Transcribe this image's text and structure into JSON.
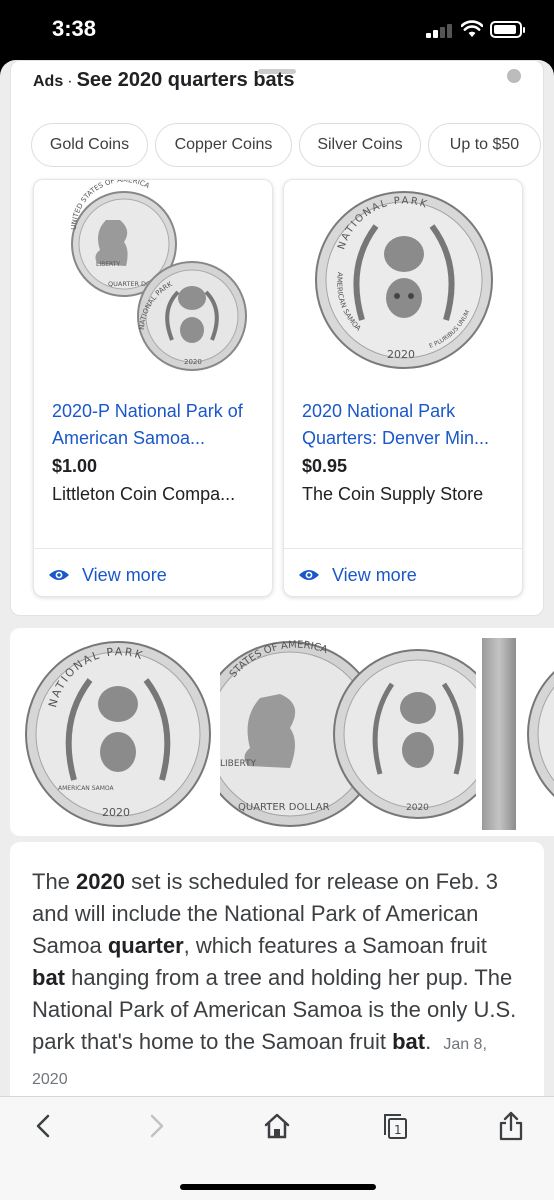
{
  "status_bar": {
    "time": "3:38"
  },
  "ads": {
    "label": "Ads",
    "separator": "·",
    "title": "See 2020 quarters bats",
    "chips": [
      "Gold Coins",
      "Copper Coins",
      "Silver Coins",
      "Up to $50"
    ],
    "products": [
      {
        "title": "2020-P National Park of American Samoa...",
        "price": "$1.00",
        "store": "Littleton Coin Compa...",
        "view_more": "View more",
        "coin_text": [
          "UNITED STATES OF AMERICA",
          "LIBERTY",
          "QUARTER DOLLAR",
          "NATIONAL PARK",
          "2020"
        ]
      },
      {
        "title": "2020 National Park Quarters: Denver Min...",
        "price": "$0.95",
        "store": "The Coin Supply Store",
        "view_more": "View more",
        "coin_text": [
          "NATIONAL PARK",
          "AMERICAN SAMOA",
          "2020",
          "E PLURIBUS UNUM"
        ]
      }
    ]
  },
  "image_strip": {
    "coin_text": [
      "NATIONAL PARK",
      "AMERICAN SAMOA",
      "2020",
      "STATES OF AMERICA",
      "LIBERTY",
      "QUARTER DOLLAR"
    ]
  },
  "snippet": {
    "parts": [
      {
        "text": "The ",
        "bold": false
      },
      {
        "text": "2020",
        "bold": true
      },
      {
        "text": " set is scheduled for release on Feb. 3 and will include the National Park of American Samoa ",
        "bold": false
      },
      {
        "text": "quarter",
        "bold": true
      },
      {
        "text": ", which features a Samoan fruit ",
        "bold": false
      },
      {
        "text": "bat",
        "bold": true
      },
      {
        "text": " hanging from a tree and holding her pup. The National Park of American Samoa is the only U.S. park that's home to the Samoan fruit ",
        "bold": false
      },
      {
        "text": "bat",
        "bold": true
      },
      {
        "text": ".",
        "bold": false
      }
    ],
    "date": "Jan 8, 2020"
  },
  "toolbar": {
    "tab_count": "1",
    "icons": [
      "back-arrow-icon",
      "forward-arrow-icon",
      "home-icon",
      "tabs-icon",
      "share-icon"
    ]
  },
  "colors": {
    "link": "#1a57c9",
    "text": "#3c4043",
    "chip_border": "#dadce0"
  }
}
